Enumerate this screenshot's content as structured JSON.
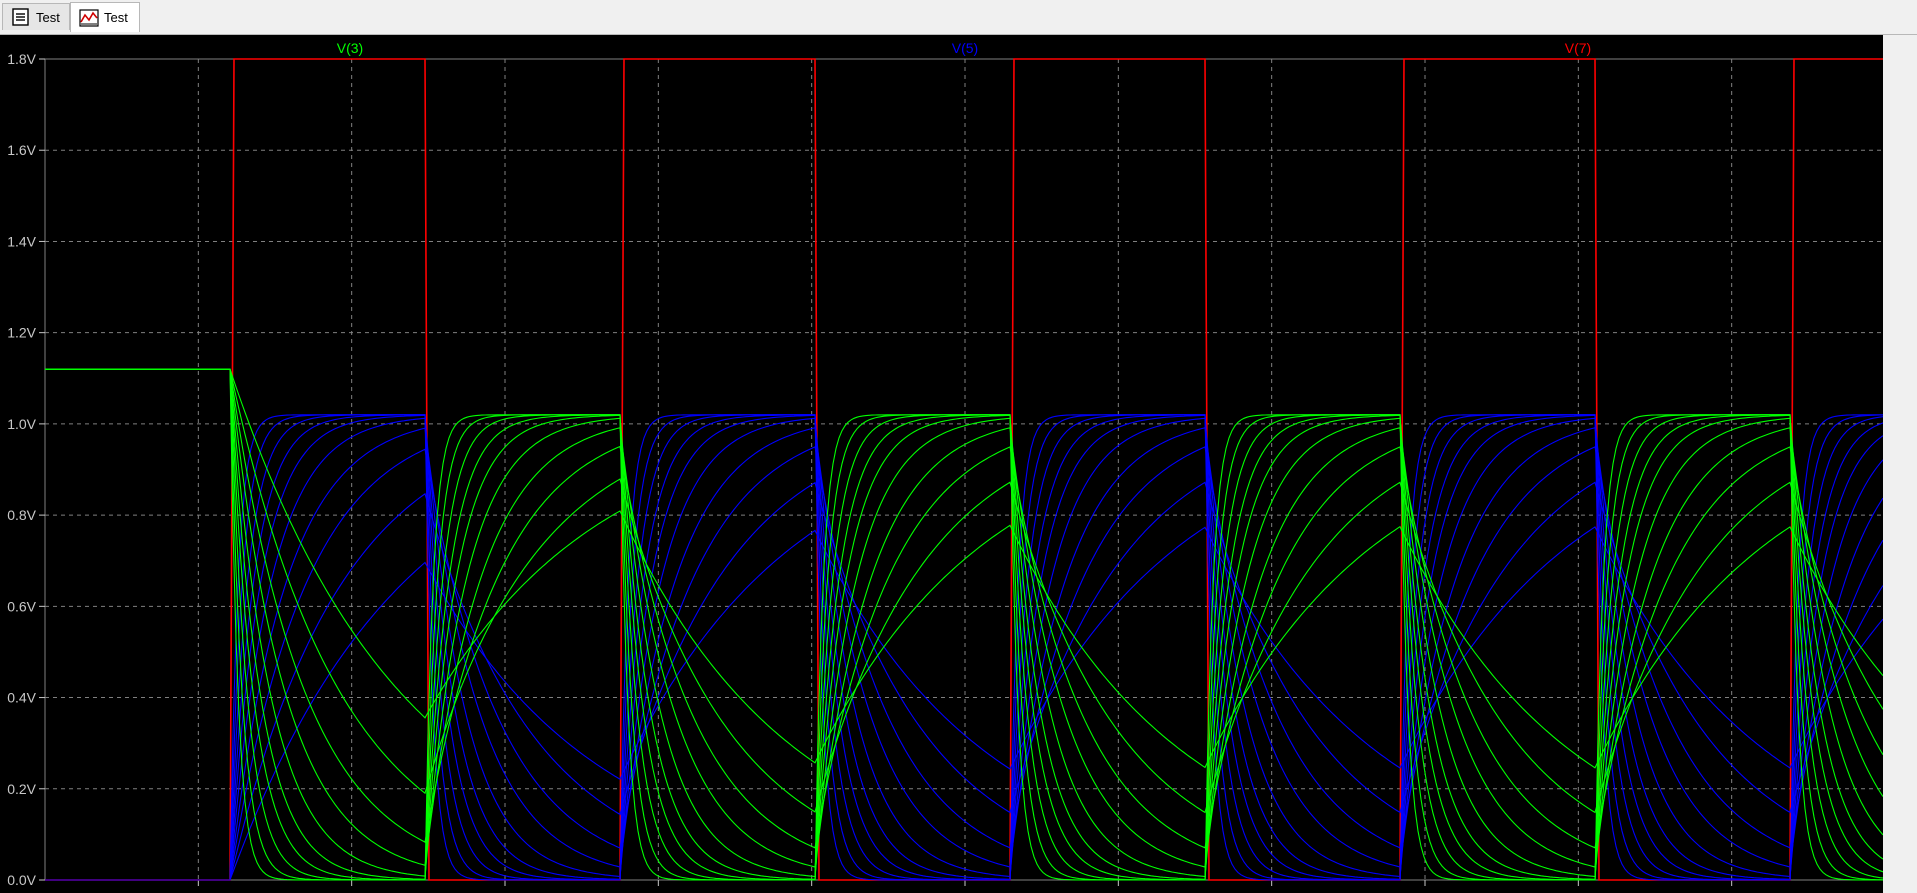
{
  "tabs": [
    {
      "label": "Test",
      "icon": "netlist-icon"
    },
    {
      "label": "Test",
      "icon": "waveform-icon",
      "active": true
    }
  ],
  "colors": {
    "background": "#000000",
    "grid": "#808080",
    "axis_text": "#c8c8c8",
    "v3": "#00ff00",
    "v5": "#0000ff",
    "v7": "#ff0000"
  },
  "chart_data": {
    "type": "line",
    "title": "",
    "xlabel": "",
    "ylabel": "",
    "ylim": [
      0,
      1.8
    ],
    "y_ticks": [
      "0.0V",
      "0.2V",
      "0.4V",
      "0.6V",
      "0.8V",
      "1.0V",
      "1.2V",
      "1.4V",
      "1.6V",
      "1.8V"
    ],
    "grid": true,
    "legend": "top",
    "series": [
      {
        "name": "V(3)",
        "color": "#00ff00",
        "description": "family of stepped curves",
        "initial": 1.12,
        "peak": 1.02
      },
      {
        "name": "V(5)",
        "color": "#0000ff",
        "description": "family of stepped curves",
        "peak": 1.02
      },
      {
        "name": "V(7)",
        "color": "#ff0000",
        "description": "square wave clock",
        "low": 0.0,
        "high": 1.8
      }
    ]
  }
}
